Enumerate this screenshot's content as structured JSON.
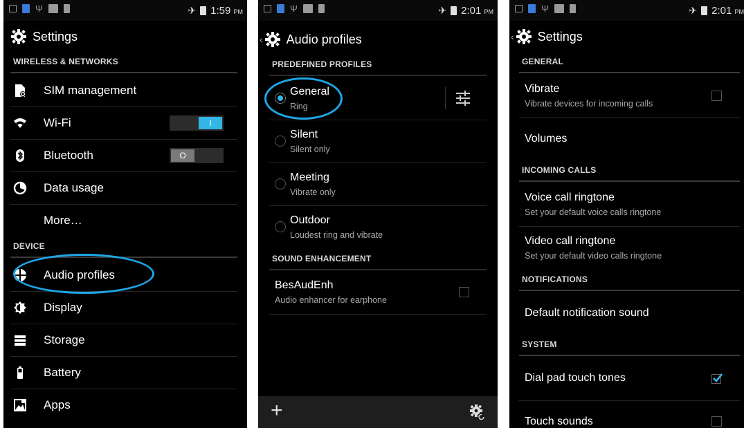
{
  "status_left": [
    "66",
    "USB"
  ],
  "screen1": {
    "time": "1:59",
    "ampm": "PM",
    "title": "Settings",
    "sections": {
      "wireless": "WIRELESS & NETWORKS",
      "device": "DEVICE"
    },
    "items": {
      "sim": "SIM management",
      "wifi": "Wi-Fi",
      "bluetooth": "Bluetooth",
      "data": "Data usage",
      "more": "More…",
      "audio": "Audio profiles",
      "display": "Display",
      "storage": "Storage",
      "battery": "Battery",
      "apps": "Apps"
    },
    "wifi_toggle": "I",
    "bt_toggle": "O"
  },
  "screen2": {
    "time": "2:01",
    "ampm": "PM",
    "title": "Audio profiles",
    "sections": {
      "predefined": "PREDEFINED PROFILES",
      "enhancement": "SOUND ENHANCEMENT"
    },
    "profiles": [
      {
        "title": "General",
        "sub": "Ring"
      },
      {
        "title": "Silent",
        "sub": "Silent only"
      },
      {
        "title": "Meeting",
        "sub": "Vibrate only"
      },
      {
        "title": "Outdoor",
        "sub": "Loudest ring and vibrate"
      }
    ],
    "enh": {
      "title": "BesAudEnh",
      "sub": "Audio enhancer for earphone"
    }
  },
  "screen3": {
    "time": "2:01",
    "ampm": "PM",
    "title": "Settings",
    "sections": {
      "general": "GENERAL",
      "incoming": "INCOMING CALLS",
      "notifications": "NOTIFICATIONS",
      "system": "SYSTEM"
    },
    "vibrate": {
      "title": "Vibrate",
      "sub": "Vibrate devices for incoming calls"
    },
    "volumes": "Volumes",
    "voice": {
      "title": "Voice call ringtone",
      "sub": "Set your default voice calls ringtone"
    },
    "video": {
      "title": "Video call ringtone",
      "sub": "Set your default video calls ringtone"
    },
    "notif_sound": "Default notification sound",
    "dialpad": "Dial pad touch tones",
    "touch": "Touch sounds"
  }
}
